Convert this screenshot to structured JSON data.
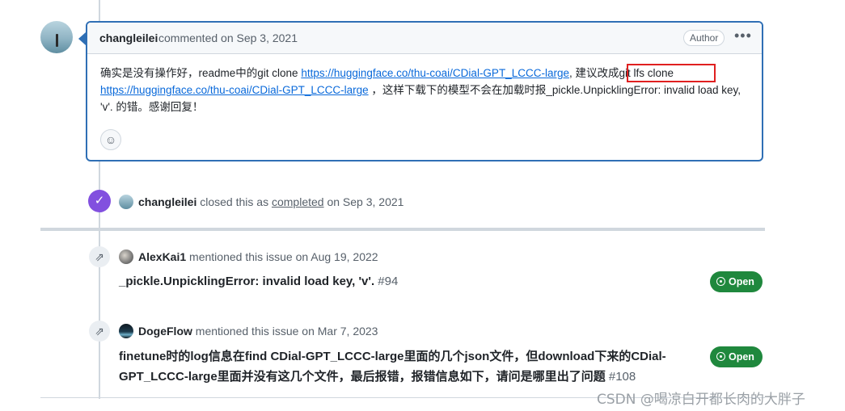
{
  "comment": {
    "author": "changleilei",
    "meta": "commented on Sep 3, 2021",
    "badge": "Author",
    "menu_icon": "kebab-horizontal-icon",
    "body_part1": "确实是没有操作好，readme中的git clone ",
    "link1": "https://huggingface.co/thu-coai/CDial-GPT_LCCC-large",
    "body_part2": ", 建议改成git lfs clone",
    "link2": "https://huggingface.co/thu-coai/CDial-GPT_LCCC-large",
    "body_part3": " ，这样下载下的模型不会在加载时报_pickle.UnpicklingError: invalid load key, 'v'. 的错。感谢回复！",
    "reaction_icon": "smiley-icon"
  },
  "closed_event": {
    "icon": "check-circle-icon",
    "user": "changleilei",
    "text1": "closed this as",
    "completed": "completed",
    "text2": "on Sep 3, 2021"
  },
  "mentions": [
    {
      "icon": "cross-reference-icon",
      "user": "AlexKai1",
      "text": "mentioned this issue on Aug 19, 2022",
      "title": "_pickle.UnpicklingError: invalid load key, 'v'.",
      "number": "#94",
      "status": "Open"
    },
    {
      "icon": "cross-reference-icon",
      "user": "DogeFlow",
      "text": "mentioned this issue on Mar 7, 2023",
      "title": "finetune时的log信息在find CDial-GPT_LCCC-large里面的几个json文件，但download下来的CDial-GPT_LCCC-large里面并没有这几个文件，最后报错，报错信息如下，请问是哪里出了问题",
      "number": "#108",
      "status": "Open"
    }
  ],
  "watermark": "CSDN @喝凉白开都长肉的大胖子",
  "colors": {
    "closed": "#8250df",
    "open": "#1f883d",
    "link": "#0969da",
    "highlight": "#e02020"
  }
}
